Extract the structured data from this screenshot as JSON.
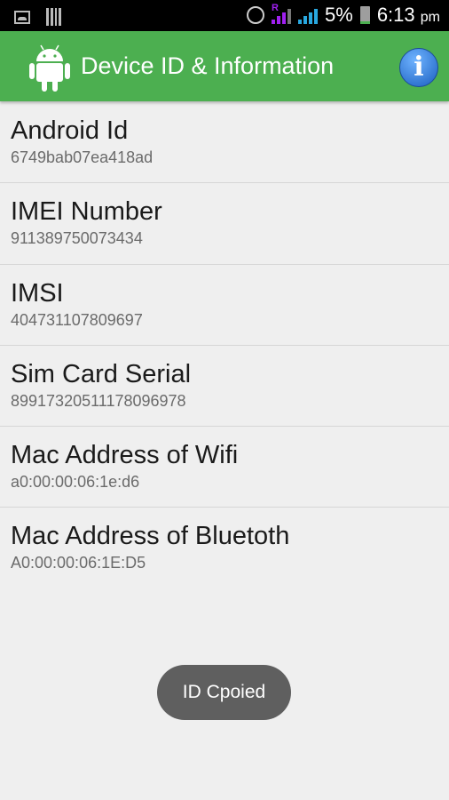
{
  "status_bar": {
    "battery": "5%",
    "time": "6:13",
    "ampm": "pm",
    "icons": [
      "image-icon",
      "barcode-icon",
      "alarm-icon",
      "roaming-signal-icon",
      "signal-icon",
      "battery-charging-icon"
    ]
  },
  "header": {
    "title": "Device ID & Information",
    "color": "#4caf50",
    "icon": "android-icon",
    "action_icon": "info-icon",
    "action_label": "i"
  },
  "items": [
    {
      "label": "Android Id",
      "value": "6749bab07ea418ad"
    },
    {
      "label": "IMEI Number",
      "value": "911389750073434"
    },
    {
      "label": "IMSI",
      "value": "404731107809697"
    },
    {
      "label": "Sim Card Serial",
      "value": "89917320511178096978"
    },
    {
      "label": "Mac Address of Wifi",
      "value": "a0:00:00:06:1e:d6"
    },
    {
      "label": "Mac Address of Bluetoth",
      "value": "A0:00:00:06:1E:D5"
    }
  ],
  "toast": {
    "text": "ID Cpoied"
  }
}
